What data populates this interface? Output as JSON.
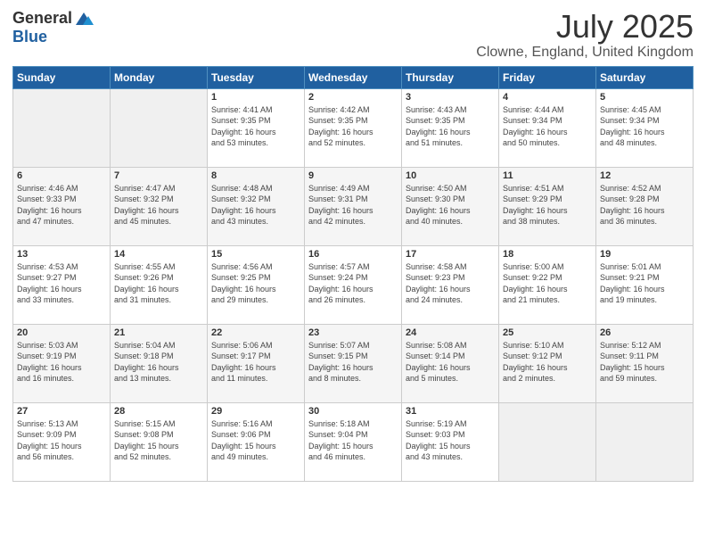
{
  "logo": {
    "general": "General",
    "blue": "Blue"
  },
  "header": {
    "title": "July 2025",
    "subtitle": "Clowne, England, United Kingdom"
  },
  "weekdays": [
    "Sunday",
    "Monday",
    "Tuesday",
    "Wednesday",
    "Thursday",
    "Friday",
    "Saturday"
  ],
  "weeks": [
    [
      {
        "day": "",
        "info": ""
      },
      {
        "day": "",
        "info": ""
      },
      {
        "day": "1",
        "info": "Sunrise: 4:41 AM\nSunset: 9:35 PM\nDaylight: 16 hours\nand 53 minutes."
      },
      {
        "day": "2",
        "info": "Sunrise: 4:42 AM\nSunset: 9:35 PM\nDaylight: 16 hours\nand 52 minutes."
      },
      {
        "day": "3",
        "info": "Sunrise: 4:43 AM\nSunset: 9:35 PM\nDaylight: 16 hours\nand 51 minutes."
      },
      {
        "day": "4",
        "info": "Sunrise: 4:44 AM\nSunset: 9:34 PM\nDaylight: 16 hours\nand 50 minutes."
      },
      {
        "day": "5",
        "info": "Sunrise: 4:45 AM\nSunset: 9:34 PM\nDaylight: 16 hours\nand 48 minutes."
      }
    ],
    [
      {
        "day": "6",
        "info": "Sunrise: 4:46 AM\nSunset: 9:33 PM\nDaylight: 16 hours\nand 47 minutes."
      },
      {
        "day": "7",
        "info": "Sunrise: 4:47 AM\nSunset: 9:32 PM\nDaylight: 16 hours\nand 45 minutes."
      },
      {
        "day": "8",
        "info": "Sunrise: 4:48 AM\nSunset: 9:32 PM\nDaylight: 16 hours\nand 43 minutes."
      },
      {
        "day": "9",
        "info": "Sunrise: 4:49 AM\nSunset: 9:31 PM\nDaylight: 16 hours\nand 42 minutes."
      },
      {
        "day": "10",
        "info": "Sunrise: 4:50 AM\nSunset: 9:30 PM\nDaylight: 16 hours\nand 40 minutes."
      },
      {
        "day": "11",
        "info": "Sunrise: 4:51 AM\nSunset: 9:29 PM\nDaylight: 16 hours\nand 38 minutes."
      },
      {
        "day": "12",
        "info": "Sunrise: 4:52 AM\nSunset: 9:28 PM\nDaylight: 16 hours\nand 36 minutes."
      }
    ],
    [
      {
        "day": "13",
        "info": "Sunrise: 4:53 AM\nSunset: 9:27 PM\nDaylight: 16 hours\nand 33 minutes."
      },
      {
        "day": "14",
        "info": "Sunrise: 4:55 AM\nSunset: 9:26 PM\nDaylight: 16 hours\nand 31 minutes."
      },
      {
        "day": "15",
        "info": "Sunrise: 4:56 AM\nSunset: 9:25 PM\nDaylight: 16 hours\nand 29 minutes."
      },
      {
        "day": "16",
        "info": "Sunrise: 4:57 AM\nSunset: 9:24 PM\nDaylight: 16 hours\nand 26 minutes."
      },
      {
        "day": "17",
        "info": "Sunrise: 4:58 AM\nSunset: 9:23 PM\nDaylight: 16 hours\nand 24 minutes."
      },
      {
        "day": "18",
        "info": "Sunrise: 5:00 AM\nSunset: 9:22 PM\nDaylight: 16 hours\nand 21 minutes."
      },
      {
        "day": "19",
        "info": "Sunrise: 5:01 AM\nSunset: 9:21 PM\nDaylight: 16 hours\nand 19 minutes."
      }
    ],
    [
      {
        "day": "20",
        "info": "Sunrise: 5:03 AM\nSunset: 9:19 PM\nDaylight: 16 hours\nand 16 minutes."
      },
      {
        "day": "21",
        "info": "Sunrise: 5:04 AM\nSunset: 9:18 PM\nDaylight: 16 hours\nand 13 minutes."
      },
      {
        "day": "22",
        "info": "Sunrise: 5:06 AM\nSunset: 9:17 PM\nDaylight: 16 hours\nand 11 minutes."
      },
      {
        "day": "23",
        "info": "Sunrise: 5:07 AM\nSunset: 9:15 PM\nDaylight: 16 hours\nand 8 minutes."
      },
      {
        "day": "24",
        "info": "Sunrise: 5:08 AM\nSunset: 9:14 PM\nDaylight: 16 hours\nand 5 minutes."
      },
      {
        "day": "25",
        "info": "Sunrise: 5:10 AM\nSunset: 9:12 PM\nDaylight: 16 hours\nand 2 minutes."
      },
      {
        "day": "26",
        "info": "Sunrise: 5:12 AM\nSunset: 9:11 PM\nDaylight: 15 hours\nand 59 minutes."
      }
    ],
    [
      {
        "day": "27",
        "info": "Sunrise: 5:13 AM\nSunset: 9:09 PM\nDaylight: 15 hours\nand 56 minutes."
      },
      {
        "day": "28",
        "info": "Sunrise: 5:15 AM\nSunset: 9:08 PM\nDaylight: 15 hours\nand 52 minutes."
      },
      {
        "day": "29",
        "info": "Sunrise: 5:16 AM\nSunset: 9:06 PM\nDaylight: 15 hours\nand 49 minutes."
      },
      {
        "day": "30",
        "info": "Sunrise: 5:18 AM\nSunset: 9:04 PM\nDaylight: 15 hours\nand 46 minutes."
      },
      {
        "day": "31",
        "info": "Sunrise: 5:19 AM\nSunset: 9:03 PM\nDaylight: 15 hours\nand 43 minutes."
      },
      {
        "day": "",
        "info": ""
      },
      {
        "day": "",
        "info": ""
      }
    ]
  ]
}
